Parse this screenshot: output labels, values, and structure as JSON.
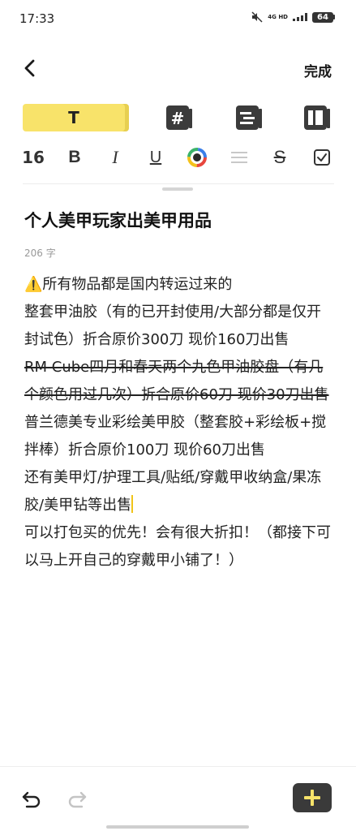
{
  "status_bar": {
    "time": "17:33",
    "network": "4G HD",
    "battery": "64"
  },
  "nav": {
    "done_label": "完成"
  },
  "toolbar": {
    "text_style_label": "T",
    "font_size": "16",
    "bold": "B",
    "italic": "I",
    "underline": "U",
    "strike": "S"
  },
  "note": {
    "title": "个人美甲玩家出美甲用品",
    "char_count": "206 字",
    "lines": {
      "l1": "⚠️所有物品都是国内转运过来的",
      "l2": "整套甲油胶（有的已开封使用/大部分都是仅开封试色）折合原价300刀 现价160刀出售",
      "l3": "RM Cube四月和春天两个九色甲油胶盘（有几个颜色用过几次）折合原价60刀 现价30刀出售",
      "l4": "普兰德美专业彩绘美甲胶（整套胶+彩绘板+搅拌棒）折合原价100刀 现价60刀出售",
      "l5": "还有美甲灯/护理工具/贴纸/穿戴甲收纳盒/果冻胶/美甲钻等出售",
      "l6": "可以打包买的优先！会有很大折扣！（都接下可以马上开自己的穿戴甲小铺了！）"
    }
  },
  "colors": {
    "accent": "#f8e36a",
    "add_button": "#3a3a3a"
  },
  "icons": {
    "back": "chevron-left-icon",
    "undo": "undo-icon",
    "redo": "redo-icon",
    "add": "plus-icon"
  }
}
